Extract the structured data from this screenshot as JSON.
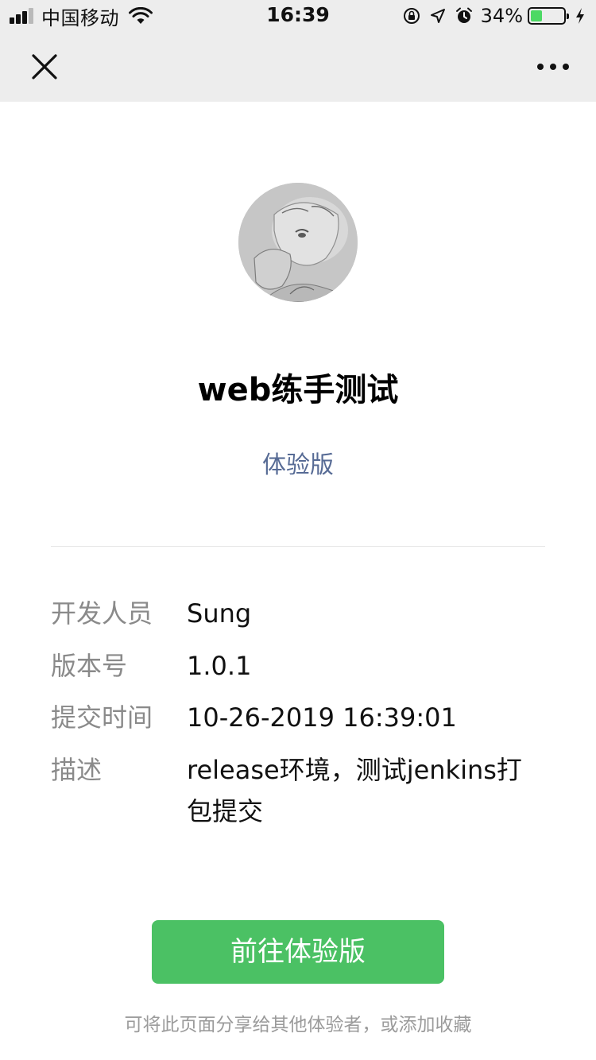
{
  "status_bar": {
    "carrier": "中国移动",
    "time": "16:39",
    "battery_percent": "34%",
    "battery_level": 0.34,
    "icons": [
      "signal-icon",
      "wifi-icon",
      "orientation-lock-icon",
      "location-icon",
      "alarm-icon",
      "battery-icon",
      "charging-icon"
    ]
  },
  "nav": {
    "close_icon": "close-icon",
    "more_icon": "more-icon"
  },
  "app": {
    "name": "web练手测试",
    "version_tag": "体验版"
  },
  "info": [
    {
      "label": "开发人员",
      "value": "Sung"
    },
    {
      "label": "版本号",
      "value": "1.0.1"
    },
    {
      "label": "提交时间",
      "value": "10-26-2019 16:39:01"
    },
    {
      "label": "描述",
      "value": "release环境，测试jenkins打包提交"
    }
  ],
  "actions": {
    "primary_button": "前往体验版",
    "share_hint": "可将此页面分享给其他体验者，或添加收藏"
  },
  "colors": {
    "accent_green": "#4bc164",
    "link_blue": "#576b95",
    "nav_bg": "#ededed"
  }
}
